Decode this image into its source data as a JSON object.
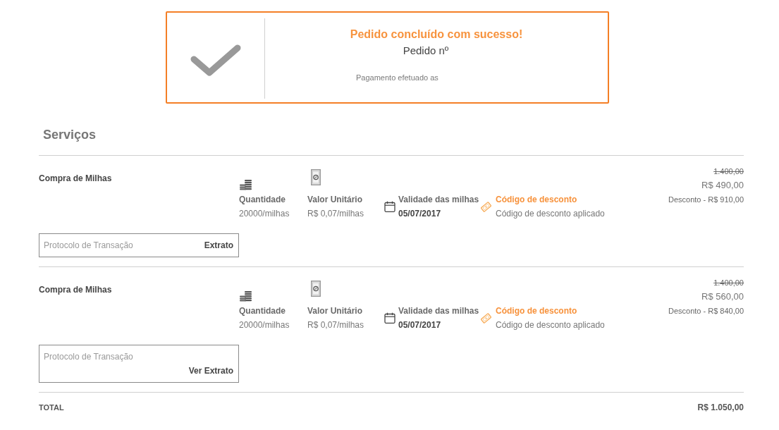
{
  "confirmation": {
    "title": "Pedido concluído com sucesso!",
    "order_label": "Pedido nº",
    "payment_label": "Pagamento efetuado as"
  },
  "section_title": "Serviços",
  "services": [
    {
      "name": "Compra de Milhas",
      "details": [
        {
          "kind": "quantity",
          "label": "Quantidade",
          "value": "20000/milhas"
        },
        {
          "kind": "unit_price",
          "label": "Valor Unitário",
          "value": "R$ 0,07/milhas"
        },
        {
          "kind": "validity",
          "label": "Validade das milhas",
          "value": "05/07/2017"
        },
        {
          "kind": "discount",
          "label": "Código de desconto",
          "value": "Código de desconto aplicado"
        }
      ],
      "original_price": "1.400,00",
      "price": "R$ 490,00",
      "discount": "Desconto - R$ 910,00",
      "protocol_field": {
        "placeholder": "Protocolo de Transação"
      },
      "statement_button": "Extrato"
    },
    {
      "name": "Compra de Milhas",
      "details": [
        {
          "kind": "quantity",
          "label": "Quantidade",
          "value": "20000/milhas"
        },
        {
          "kind": "unit_price",
          "label": "Valor Unitário",
          "value": "R$ 0,07/milhas"
        },
        {
          "kind": "validity",
          "label": "Validade das milhas",
          "value": "05/07/2017"
        },
        {
          "kind": "discount",
          "label": "Código de desconto",
          "value": "Código de desconto aplicado"
        }
      ],
      "original_price": "1.400,00",
      "price": "R$ 560,00",
      "discount": "Desconto - R$ 840,00",
      "protocol_field": {
        "placeholder": "Protocolo de Transação"
      },
      "statement_button": "Ver Extrato"
    }
  ],
  "total": {
    "label": "TOTAL",
    "value": "R$ 1.050,00"
  }
}
